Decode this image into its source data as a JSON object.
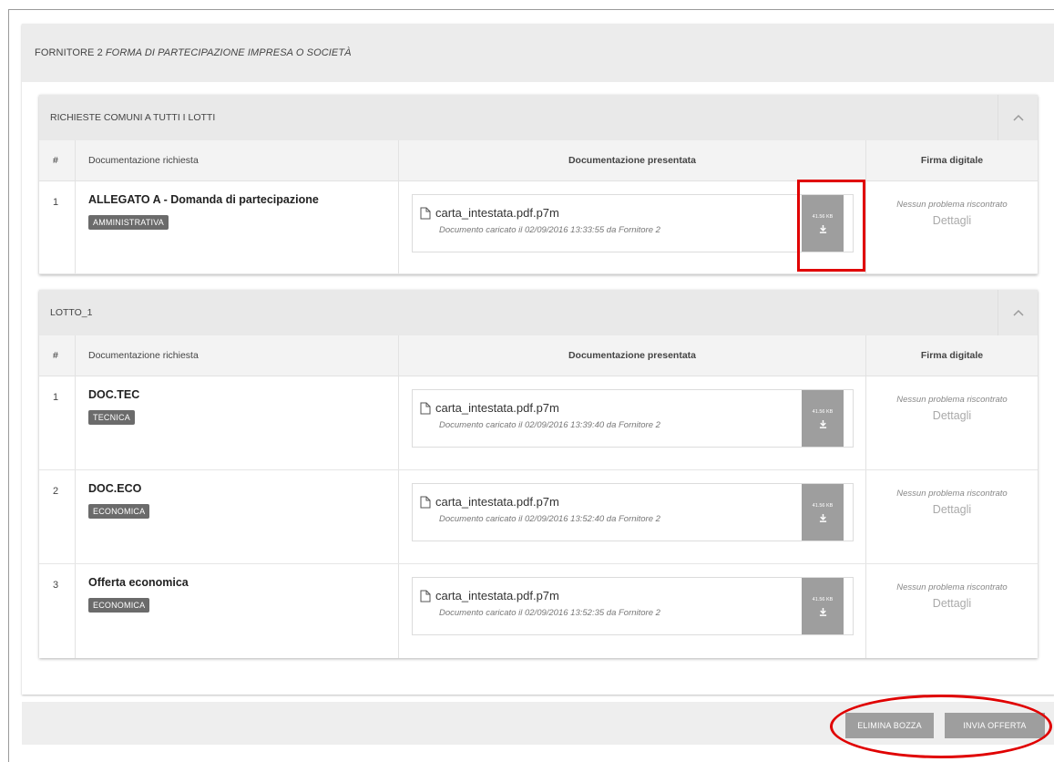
{
  "header": {
    "prefix": "FORNITORE 2",
    "italic": "FORMA DI PARTECIPAZIONE IMPRESA O SOCIETÀ"
  },
  "columns": {
    "num": "#",
    "required": "Documentazione richiesta",
    "presented": "Documentazione presentata",
    "signature": "Firma digitale"
  },
  "sections": [
    {
      "title": "RICHIESTE COMUNI A TUTTI I LOTTI",
      "rows": [
        {
          "num": "1",
          "title": "ALLEGATO A - Domanda di partecipazione",
          "badge": "AMMINISTRATIVA",
          "file_name": "carta_intestata.pdf.p7m",
          "file_meta": "Documento caricato il 02/09/2016 13:33:55 da Fornitore 2",
          "file_size": "41.56 KB",
          "status": "Nessun problema riscontrato",
          "details": "Dettagli"
        }
      ]
    },
    {
      "title": "LOTTO_1",
      "rows": [
        {
          "num": "1",
          "title": "DOC.TEC",
          "badge": "TECNICA",
          "file_name": "carta_intestata.pdf.p7m",
          "file_meta": "Documento caricato il 02/09/2016 13:39:40 da Fornitore 2",
          "file_size": "41.56 KB",
          "status": "Nessun problema riscontrato",
          "details": "Dettagli"
        },
        {
          "num": "2",
          "title": "DOC.ECO",
          "badge": "ECONOMICA",
          "file_name": "carta_intestata.pdf.p7m",
          "file_meta": "Documento caricato il 02/09/2016 13:52:40 da Fornitore 2",
          "file_size": "41.56 KB",
          "status": "Nessun problema riscontrato",
          "details": "Dettagli"
        },
        {
          "num": "3",
          "title": "Offerta economica",
          "badge": "ECONOMICA",
          "file_name": "carta_intestata.pdf.p7m",
          "file_meta": "Documento caricato il 02/09/2016 13:52:35 da Fornitore 2",
          "file_size": "41.56 KB",
          "status": "Nessun problema riscontrato",
          "details": "Dettagli"
        }
      ]
    }
  ],
  "footer": {
    "delete_label": "ELIMINA BOZZA",
    "send_label": "INVIA OFFERTA"
  },
  "colors": {
    "highlight": "#e00000",
    "button": "#9e9e9e",
    "badge": "#6b6b6b"
  },
  "icons": [
    "file-icon",
    "download-icon",
    "chevron-up-icon"
  ]
}
